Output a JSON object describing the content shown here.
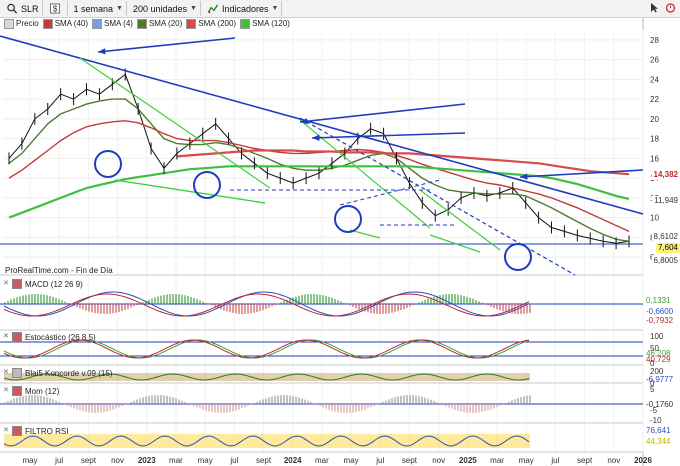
{
  "toolbar": {
    "symbol": "SLR",
    "period": "1 semana",
    "units": "200 unidades",
    "indicators": "Indicadores"
  },
  "legend": [
    {
      "label": "Precio",
      "color": "#d8d8d8"
    },
    {
      "label": "SMA (40)",
      "color": "#c23b3b"
    },
    {
      "label": "SMA (4)",
      "color": "#7c9be0"
    },
    {
      "label": "SMA (20)",
      "color": "#4f7a2a"
    },
    {
      "label": "SMA (200)",
      "color": "#d94a4a"
    },
    {
      "label": "SMA (120)",
      "color": "#3fbf3f"
    }
  ],
  "source_label": "ProRealTime.com - Fin de Día",
  "price_labels": [
    {
      "text": "14,382",
      "color": "#c0282d",
      "bg": "#ffffff"
    },
    {
      "text": "11,949",
      "color": "#333333",
      "bg": "#ffffff"
    },
    {
      "text": "8,6102",
      "color": "#333333",
      "bg": "#ffffff"
    },
    {
      "text": "7,604",
      "color": "#000000",
      "bg": "#fff27a"
    },
    {
      "text": "6,8005",
      "color": "#333333",
      "bg": "#ffffff"
    }
  ],
  "panes": {
    "macd": {
      "title": "MACD (12 26 9)",
      "values": [
        "0,1331",
        "-0,6600",
        "-0,7932"
      ],
      "colors": [
        "#3aa03a",
        "#2a4fbf",
        "#c0282d"
      ]
    },
    "stoch": {
      "title": "Estocástico (26 8 5)",
      "values": [
        "46,208",
        "40,729"
      ],
      "colors": [
        "#3aa03a",
        "#c0282d"
      ],
      "ticks": [
        "100",
        "50",
        "0"
      ]
    },
    "blai": {
      "title": "Blai5 Koncorde v.09 (15)",
      "values": [
        "-6,9777"
      ],
      "colors": [
        "#2a4fbf"
      ],
      "ticks": [
        "200",
        "0"
      ]
    },
    "mom": {
      "title": "Mom (12)",
      "values": [
        "-0,1760"
      ],
      "colors": [
        "#333333"
      ],
      "ticks": [
        "5",
        "-5",
        "-10"
      ]
    },
    "filtro": {
      "title": "FILTRO RSI",
      "values": [
        "76,641",
        "44,344"
      ],
      "colors": [
        "#2a4fbf",
        "#c9b400"
      ]
    }
  },
  "chart_data": {
    "type": "line",
    "title": "SLR",
    "interval": "1 semana",
    "y_axis": {
      "ticks": [
        28,
        26,
        24,
        22,
        20,
        18,
        16,
        14,
        12,
        10,
        8,
        6
      ],
      "ylim": [
        5,
        29
      ]
    },
    "x_axis": {
      "tick_labels": [
        "may",
        "jul",
        "sept",
        "nov",
        "2023",
        "mar",
        "may",
        "jul",
        "sept",
        "2024",
        "mar",
        "may",
        "jul",
        "sept",
        "nov",
        "2025",
        "mar",
        "may",
        "jul",
        "sept",
        "nov",
        "2026"
      ]
    },
    "series": [
      {
        "name": "Precio",
        "values": [
          16,
          17.5,
          20,
          21,
          22.5,
          22,
          23,
          22.5,
          23.5,
          24.5,
          21,
          17,
          15,
          16.5,
          17.5,
          18.5,
          19.5,
          18,
          16.5,
          15.5,
          14.5,
          14,
          13.5,
          14,
          14.5,
          15.5,
          16.5,
          18,
          19,
          18.5,
          16,
          13.5,
          11.5,
          10.2,
          10.8,
          12,
          12.5,
          12.2,
          12.5,
          13,
          11.5,
          10,
          9,
          8.6,
          8.2,
          7.9,
          7.6,
          7.4,
          7.6
        ]
      },
      {
        "name": "SMA (20)",
        "values": [
          15.5,
          16.5,
          18,
          19.5,
          20.5,
          21,
          21.5,
          21.8,
          22,
          22,
          21,
          19.5,
          18,
          17.5,
          17.4,
          17.4,
          17.6,
          17.4,
          17,
          16.5,
          16,
          15.4,
          15,
          14.8,
          14.8,
          15,
          15.3,
          15.8,
          16.3,
          16.5,
          16,
          15,
          14,
          13.3,
          12.8,
          12.6,
          12.5,
          12.4,
          12.4,
          12.4,
          12.2,
          11.6,
          11,
          10.3,
          9.6,
          8.9,
          8.3,
          7.8,
          7.6
        ]
      },
      {
        "name": "SMA (40)",
        "values": [
          14,
          14.8,
          15.8,
          16.8,
          17.8,
          18.6,
          19.2,
          19.5,
          19.7,
          19.8,
          19.6,
          19.1,
          18.5,
          18,
          17.8,
          17.8,
          17.8,
          17.6,
          17.3,
          17,
          16.8,
          16.6,
          16.5,
          16.5,
          16.6,
          16.7,
          16.8,
          16.9,
          16.8,
          16.6,
          16.3,
          15.9,
          15.4,
          15,
          14.6,
          14.2,
          13.8,
          13.5,
          13.3,
          13,
          12.7,
          12.4,
          12,
          11.5,
          11,
          10.4,
          9.8,
          9.2,
          8.6
        ]
      },
      {
        "name": "SMA (120)",
        "values": [
          10,
          10.5,
          11,
          11.5,
          12,
          12.5,
          13,
          13.3,
          13.6,
          13.9,
          14.1,
          14.3,
          14.5,
          14.7,
          14.9,
          15,
          15.1,
          15.2,
          15.2,
          15.2,
          15.2,
          15.2,
          15.2,
          15.2,
          15.2,
          15.2,
          15.2,
          15.2,
          15.2,
          15.2,
          15.2,
          15.2,
          15.1,
          15,
          14.9,
          14.8,
          14.7,
          14.6,
          14.5,
          14.4,
          14.3,
          14.2,
          14,
          13.7,
          13.4,
          13,
          12.6,
          12.2,
          11.9
        ]
      },
      {
        "name": "SMA (200)",
        "values": [
          null,
          null,
          null,
          null,
          null,
          null,
          null,
          null,
          null,
          null,
          null,
          null,
          null,
          16.2,
          16.3,
          16.4,
          16.5,
          16.6,
          16.7,
          16.8,
          16.8,
          16.8,
          16.8,
          16.7,
          16.7,
          16.7,
          16.6,
          16.6,
          16.6,
          16.5,
          16.5,
          16.5,
          16.4,
          16.3,
          16.2,
          16.1,
          16,
          15.9,
          15.8,
          15.7,
          15.6,
          15.5,
          15.3,
          15.1,
          14.9,
          14.7,
          14.6,
          14.5,
          14.4
        ]
      }
    ]
  }
}
